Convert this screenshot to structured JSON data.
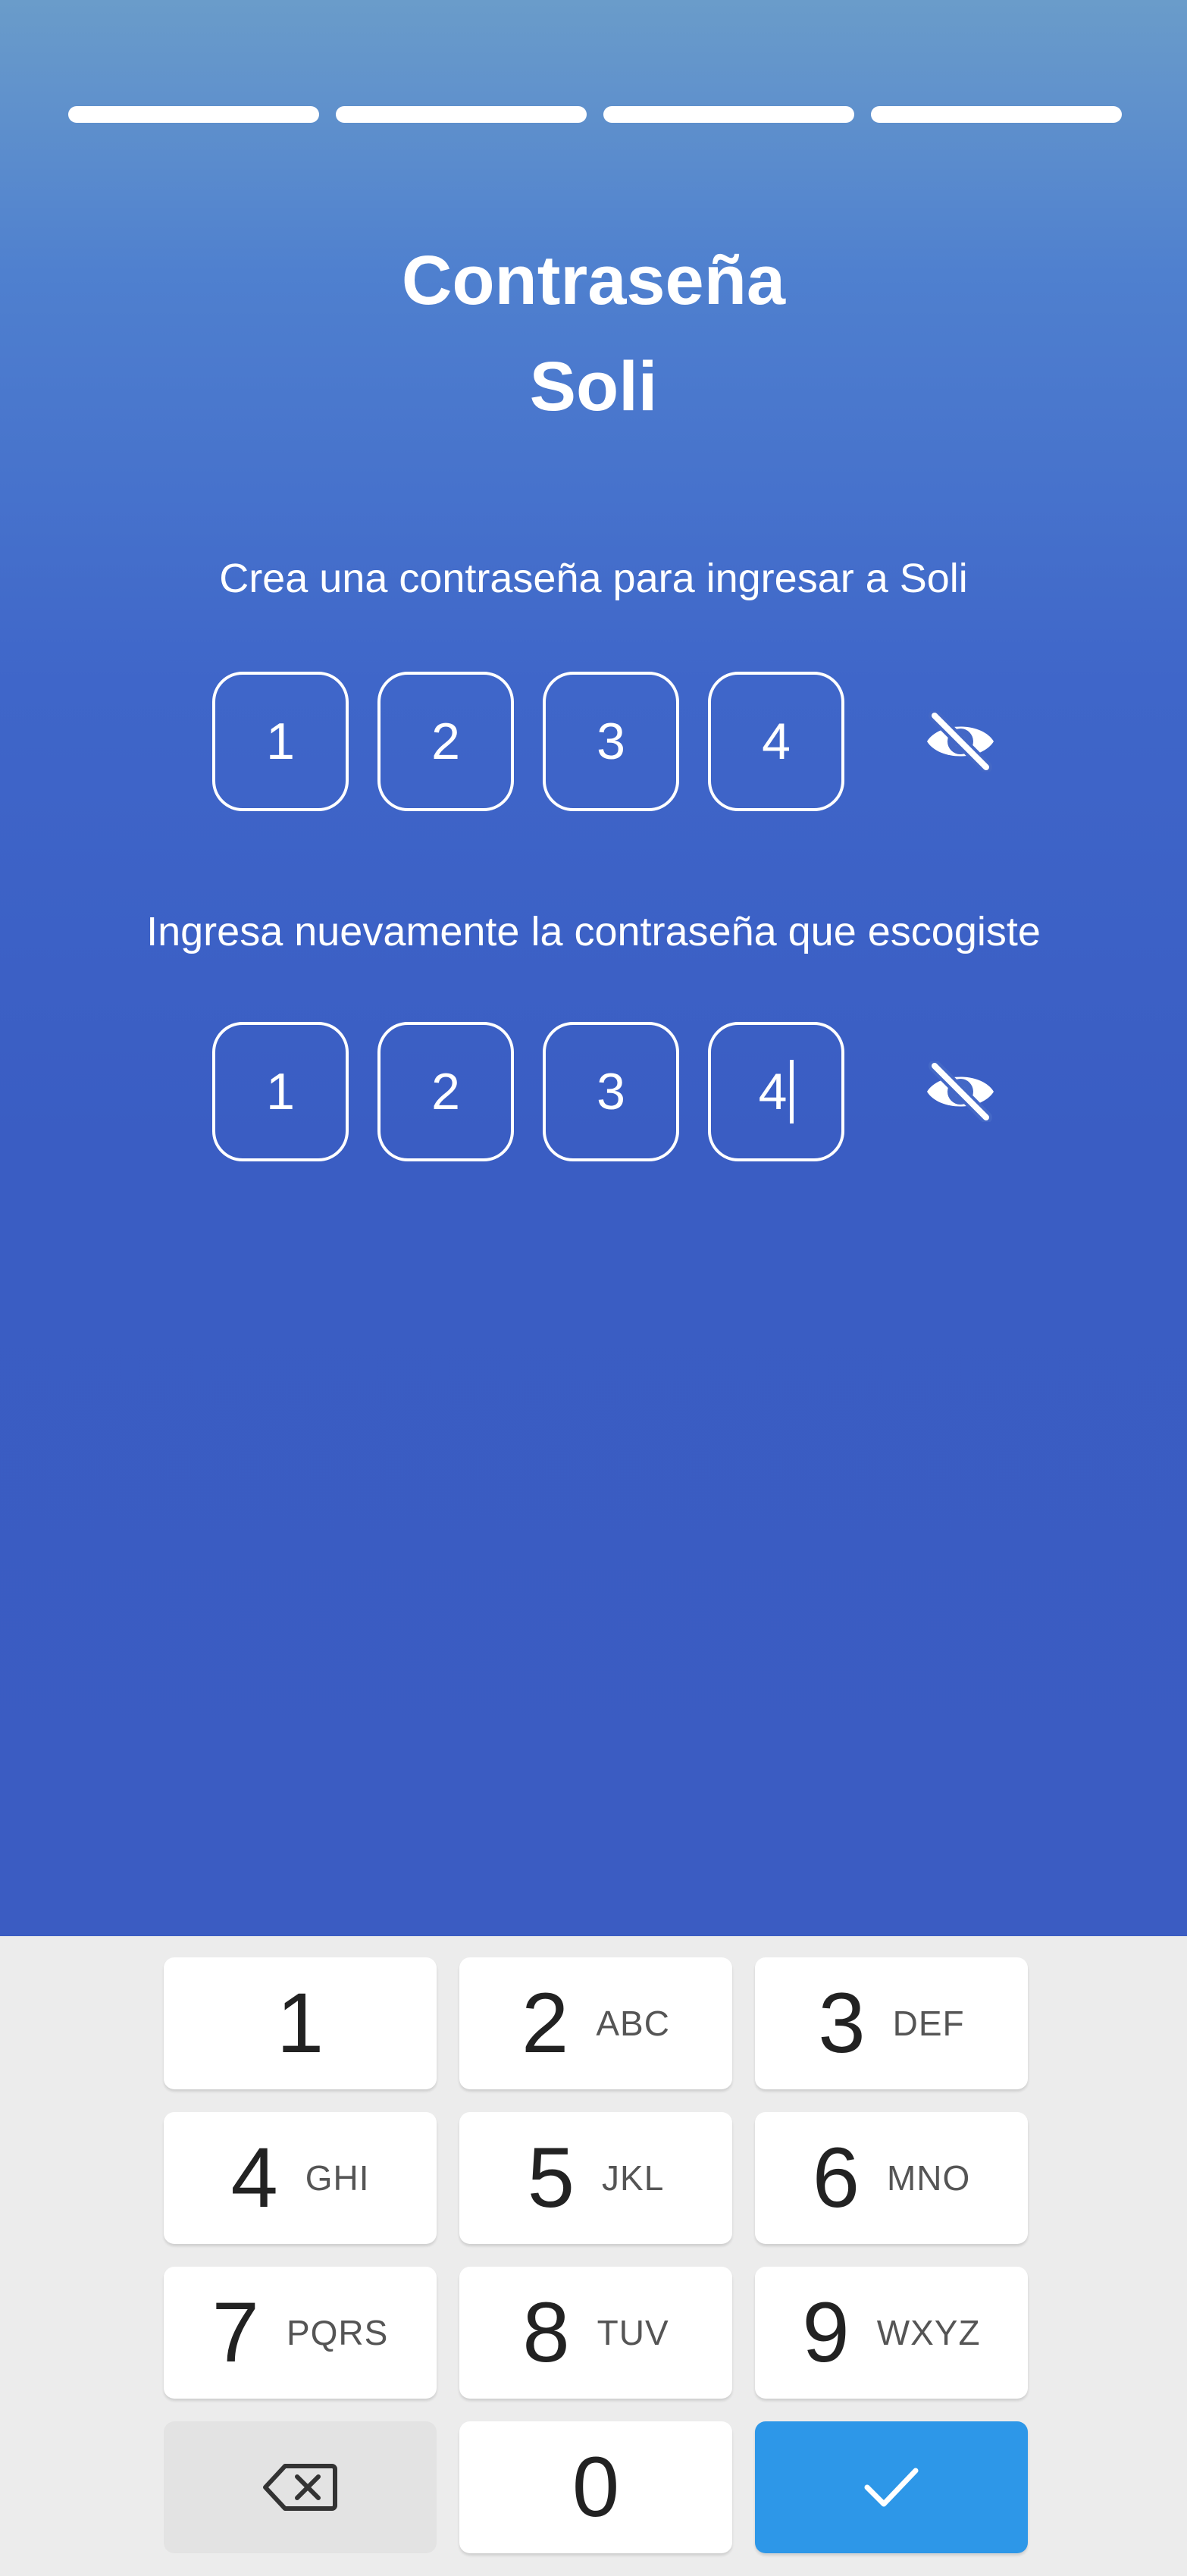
{
  "progress": {
    "segments": 4,
    "completed": 4
  },
  "title": {
    "line1": "Contraseña",
    "line2": "Soli"
  },
  "create": {
    "label": "Crea una contraseña para ingresar a Soli",
    "digits": [
      "1",
      "2",
      "3",
      "4"
    ]
  },
  "confirm": {
    "label": "Ingresa nuevamente la contraseña que escogiste",
    "digits": [
      "1",
      "2",
      "3",
      "4"
    ]
  },
  "keyboard": {
    "keys": [
      {
        "num": "1",
        "letters": ""
      },
      {
        "num": "2",
        "letters": "ABC"
      },
      {
        "num": "3",
        "letters": "DEF"
      },
      {
        "num": "4",
        "letters": "GHI"
      },
      {
        "num": "5",
        "letters": "JKL"
      },
      {
        "num": "6",
        "letters": "MNO"
      },
      {
        "num": "7",
        "letters": "PQRS"
      },
      {
        "num": "8",
        "letters": "TUV"
      },
      {
        "num": "9",
        "letters": "WXYZ"
      }
    ],
    "zero": "0"
  },
  "colors": {
    "accent": "#2d97e8",
    "background_top": "#6a9cca",
    "background_bottom": "#3b5cc2"
  },
  "icons": {
    "visibility_toggle": "eye-off-icon",
    "backspace": "backspace-icon",
    "done": "check-icon"
  }
}
